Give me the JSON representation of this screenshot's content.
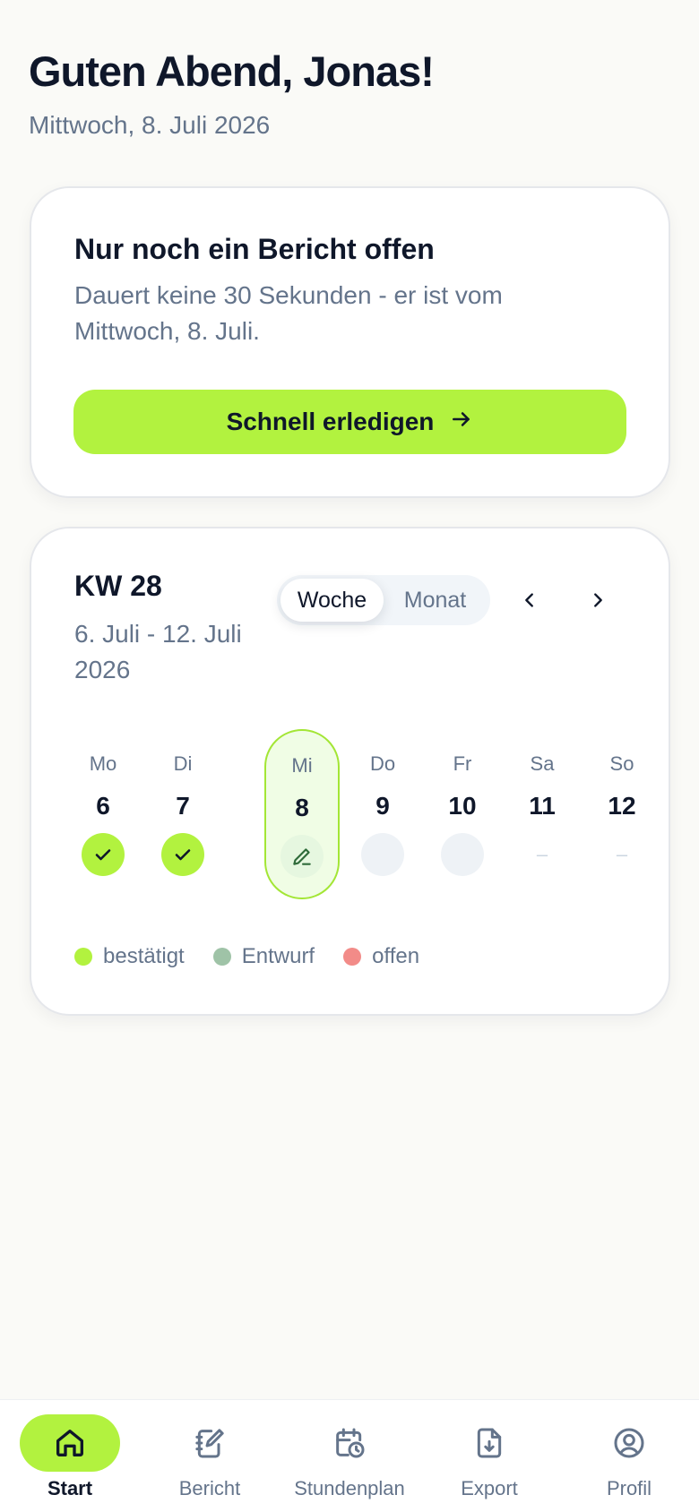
{
  "header": {
    "greeting": "Guten Abend, Jonas!",
    "date": "Mittwoch, 8. Juli 2026"
  },
  "report_card": {
    "title": "Nur noch ein Bericht offen",
    "text": "Dauert keine 30 Sekunden - er ist vom Mittwoch, 8. Juli.",
    "button_label": "Schnell erledigen",
    "button_icon": "arrow-right-icon"
  },
  "week_card": {
    "week_label": "KW 28",
    "range": "6. Juli - 12. Juli 2026",
    "toggle": {
      "week": "Woche",
      "month": "Monat",
      "selected": "Woche"
    },
    "days": [
      {
        "name": "Mo",
        "num": "6",
        "status": "bestätigt"
      },
      {
        "name": "Di",
        "num": "7",
        "status": "bestätigt"
      },
      {
        "name": "Mi",
        "num": "8",
        "status": "Entwurf",
        "today": true
      },
      {
        "name": "Do",
        "num": "9",
        "status": "offen"
      },
      {
        "name": "Fr",
        "num": "10",
        "status": "offen"
      },
      {
        "name": "Sa",
        "num": "11",
        "status": "–"
      },
      {
        "name": "So",
        "num": "12",
        "status": "–"
      }
    ],
    "legend": [
      {
        "label": "bestätigt",
        "color": "#b2f23f"
      },
      {
        "label": "Entwurf",
        "color": "#9fc3a7"
      },
      {
        "label": "offen",
        "color": "#f28b88"
      }
    ]
  },
  "tabbar": {
    "items": [
      {
        "label": "Start",
        "icon": "home-icon",
        "active": true
      },
      {
        "label": "Bericht",
        "icon": "notebook-edit-icon"
      },
      {
        "label": "Stundenplan",
        "icon": "calendar-clock-icon"
      },
      {
        "label": "Export",
        "icon": "file-download-icon"
      },
      {
        "label": "Profil",
        "icon": "user-circle-icon"
      }
    ]
  },
  "colors": {
    "accent": "#b2f23f",
    "text": "#0f172a",
    "muted": "#64748b",
    "background": "#fafaf7"
  }
}
